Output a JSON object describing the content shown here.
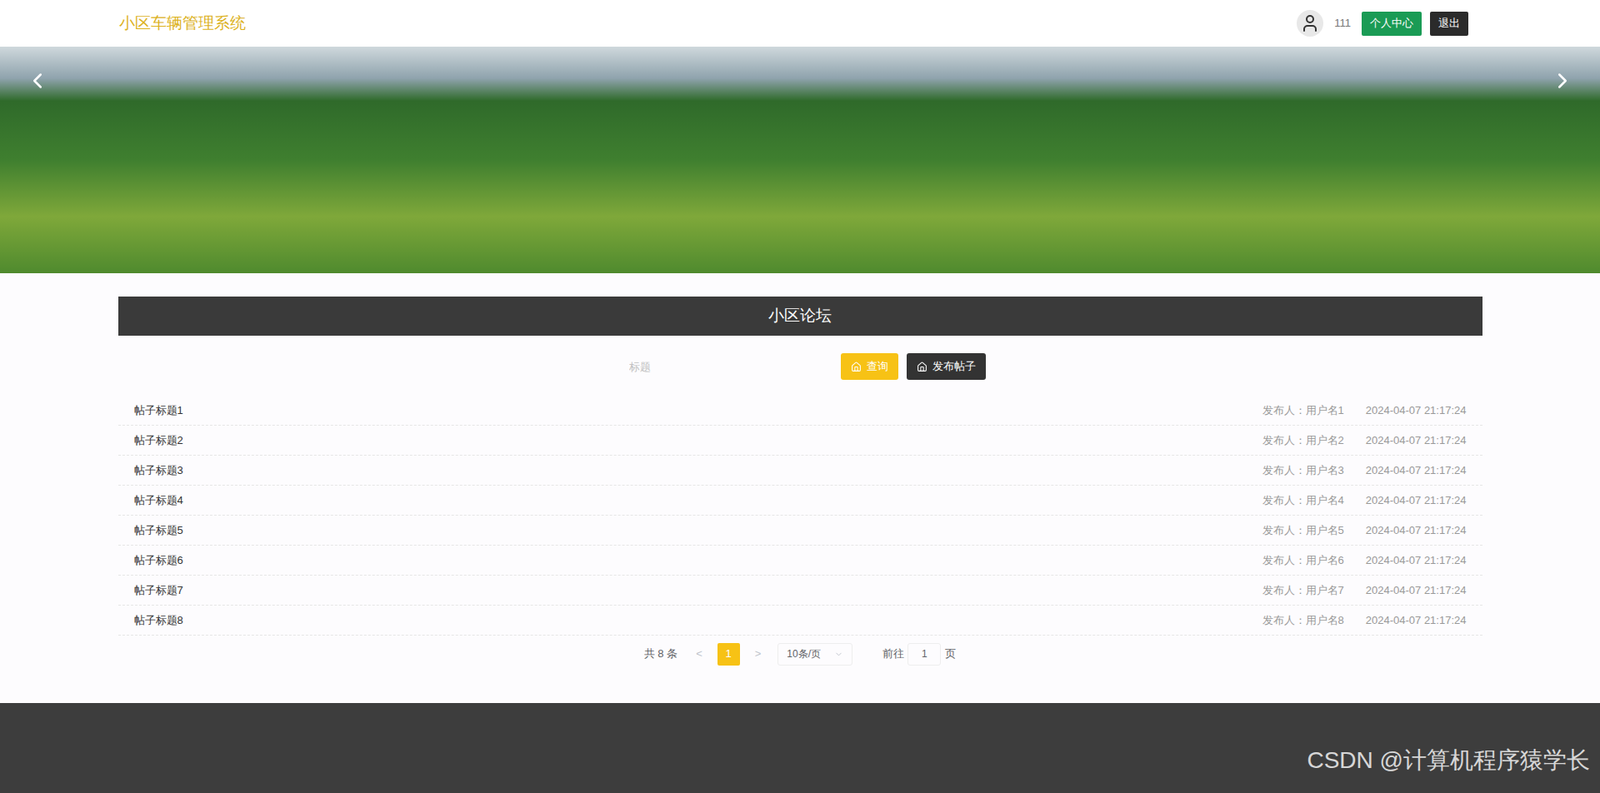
{
  "header": {
    "title": "小区车辆管理系统",
    "username": "111",
    "buttons": [
      "个人中心",
      "退出"
    ]
  },
  "section": {
    "title": "小区论坛"
  },
  "search": {
    "placeholder": "标题",
    "buttons": [
      "查询",
      "发布帖子"
    ]
  },
  "posts": [
    {
      "title": "帖子标题1",
      "author": "发布人：用户名1",
      "time": "2024-04-07 21:17:24"
    },
    {
      "title": "帖子标题2",
      "author": "发布人：用户名2",
      "time": "2024-04-07 21:17:24"
    },
    {
      "title": "帖子标题3",
      "author": "发布人：用户名3",
      "time": "2024-04-07 21:17:24"
    },
    {
      "title": "帖子标题4",
      "author": "发布人：用户名4",
      "time": "2024-04-07 21:17:24"
    },
    {
      "title": "帖子标题5",
      "author": "发布人：用户名5",
      "time": "2024-04-07 21:17:24"
    },
    {
      "title": "帖子标题6",
      "author": "发布人：用户名6",
      "time": "2024-04-07 21:17:24"
    },
    {
      "title": "帖子标题7",
      "author": "发布人：用户名7",
      "time": "2024-04-07 21:17:24"
    },
    {
      "title": "帖子标题8",
      "author": "发布人：用户名8",
      "time": "2024-04-07 21:17:24"
    }
  ],
  "pagination": {
    "total": "共 8 条",
    "prev": "<",
    "pages": [
      {
        "label": "1",
        "selected": true
      }
    ],
    "next": ">",
    "page_size": "10条/页",
    "goto_label": "前往",
    "goto_value": "1",
    "goto_suffix": "页"
  },
  "watermark": "CSDN @计算机程序猿学长"
}
